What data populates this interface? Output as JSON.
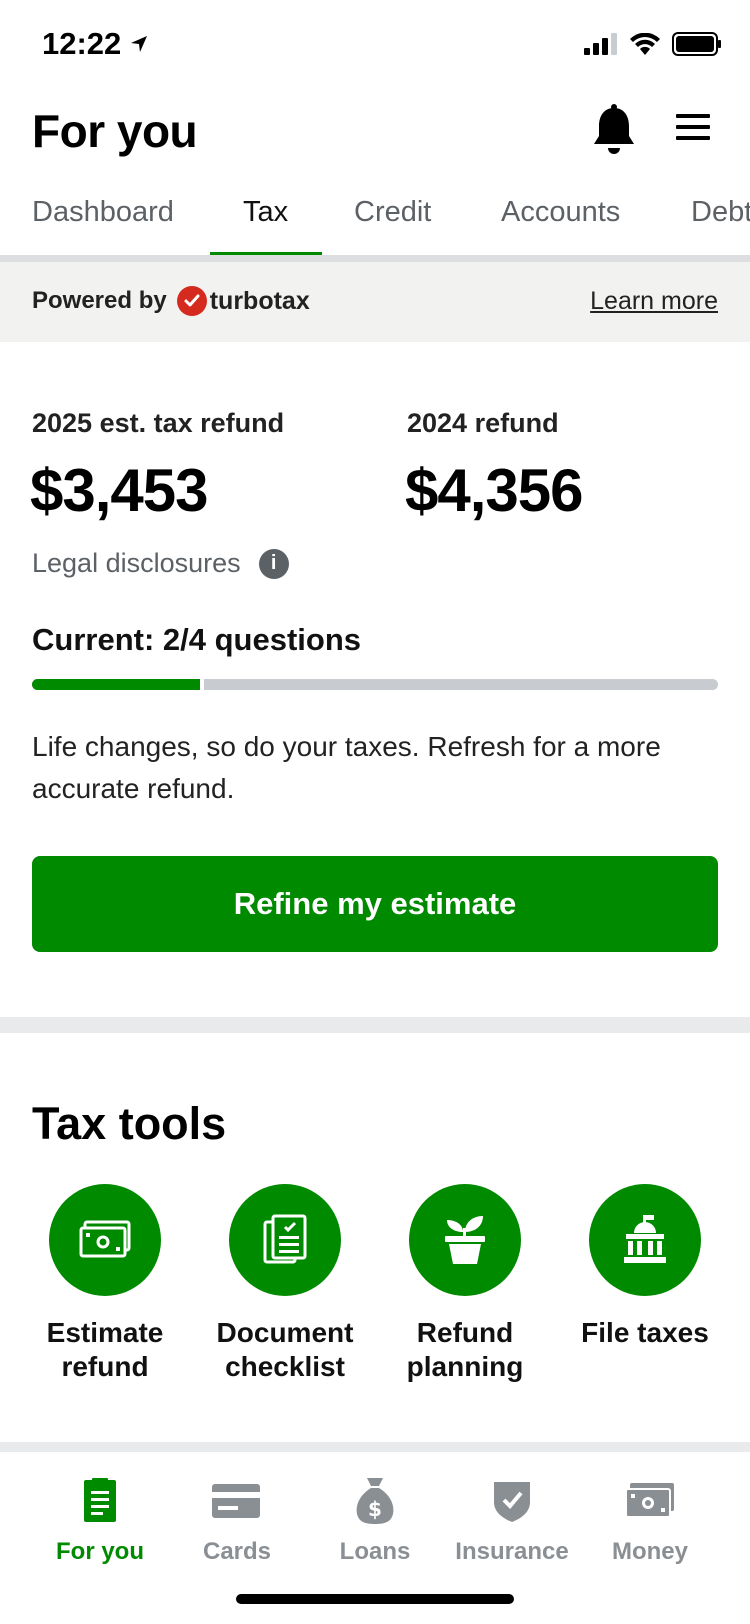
{
  "status_bar": {
    "time": "12:22"
  },
  "header": {
    "title": "For you"
  },
  "tabs": [
    {
      "label": "Dashboard",
      "active": false
    },
    {
      "label": "Tax",
      "active": true
    },
    {
      "label": "Credit",
      "active": false
    },
    {
      "label": "Accounts",
      "active": false
    },
    {
      "label": "Debt",
      "active": false
    }
  ],
  "powered_banner": {
    "prefix": "Powered by",
    "brand": "turbotax",
    "link": "Learn more"
  },
  "refund": {
    "estimate_label": "2025 est. tax refund",
    "estimate_amount": "$3,453",
    "prior_label": "2024 refund",
    "prior_amount": "$4,356",
    "legal": "Legal disclosures"
  },
  "progress": {
    "label": "Current: 2/4 questions",
    "fraction": 0.25
  },
  "message": "Life changes, so do your taxes. Refresh for a more accurate refund.",
  "cta_label": "Refine my estimate",
  "tax_tools": {
    "title": "Tax tools",
    "items": [
      {
        "label": "Estimate refund",
        "icon": "money-bill-icon"
      },
      {
        "label": "Document checklist",
        "icon": "document-checklist-icon"
      },
      {
        "label": "Refund planning",
        "icon": "plant-pot-icon"
      },
      {
        "label": "File taxes",
        "icon": "government-building-icon"
      }
    ]
  },
  "bottom_nav": [
    {
      "label": "For you",
      "active": true,
      "icon": "document-icon"
    },
    {
      "label": "Cards",
      "active": false,
      "icon": "card-icon"
    },
    {
      "label": "Loans",
      "active": false,
      "icon": "money-bag-icon"
    },
    {
      "label": "Insurance",
      "active": false,
      "icon": "shield-check-icon"
    },
    {
      "label": "Money",
      "active": false,
      "icon": "money-bill-icon"
    }
  ],
  "colors": {
    "brand_green": "#008a00",
    "muted_text": "#5c6166",
    "turbotax_red": "#d52b1e"
  }
}
